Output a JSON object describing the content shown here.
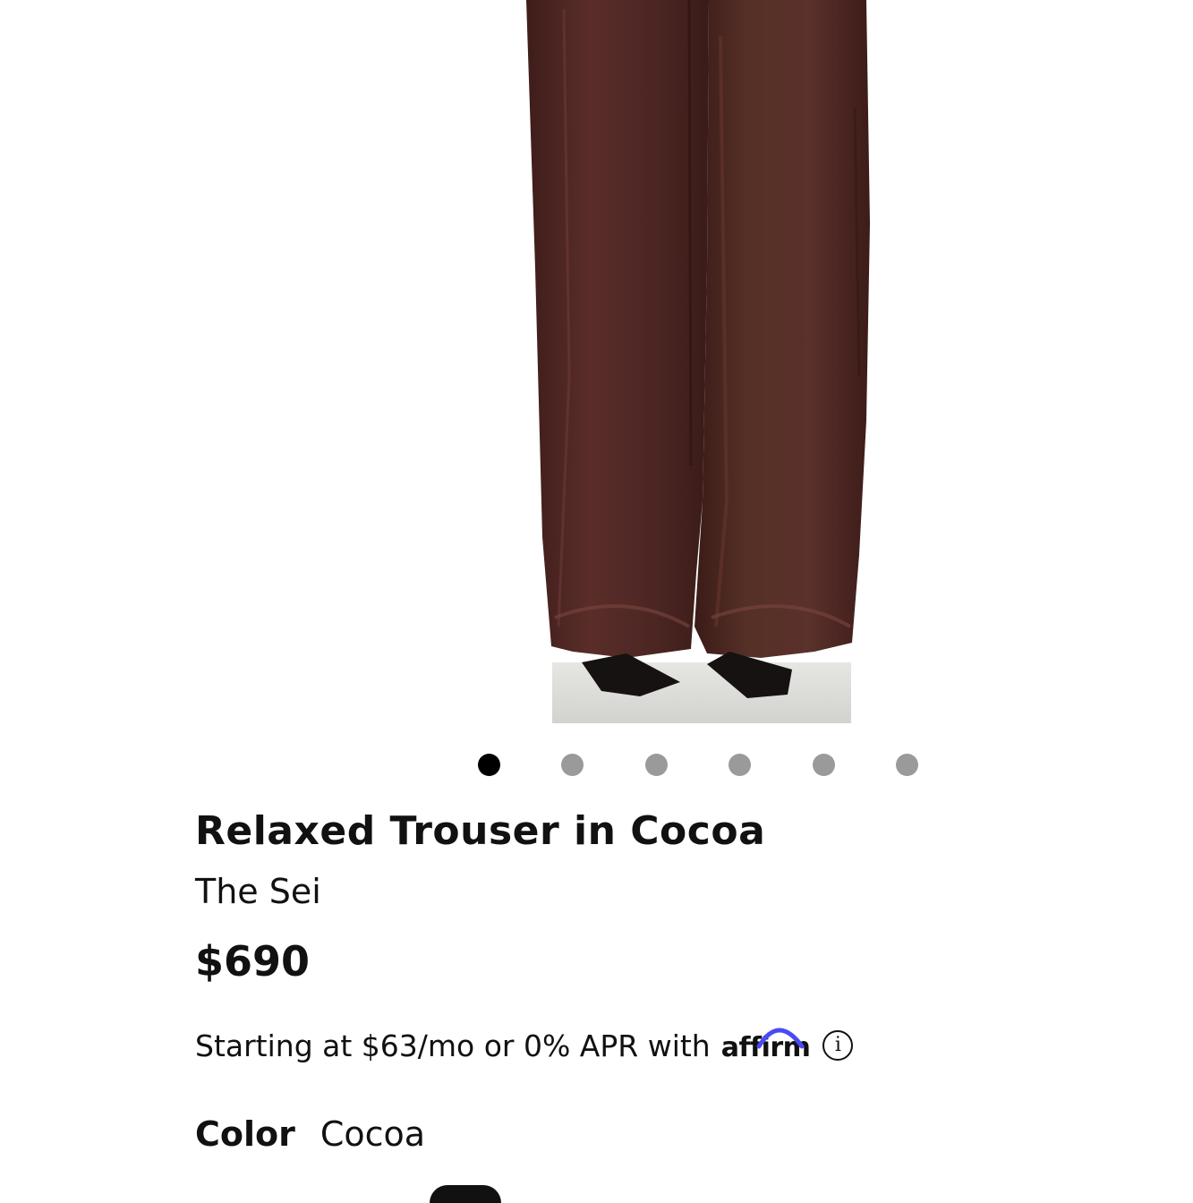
{
  "product": {
    "title": "Relaxed Trouser in Cocoa",
    "brand": "The Sei",
    "price": "$690"
  },
  "financing": {
    "text": "Starting at $63/mo or 0% APR with",
    "provider": "affirm"
  },
  "color": {
    "label": "Color",
    "value": "Cocoa"
  },
  "carousel": {
    "total": 6,
    "active_index": 0
  },
  "colors": {
    "accent": "#000000",
    "dot_inactive": "#9a9a9a",
    "affirm_arc": "#4a4af4",
    "trouser": "#4e2622"
  }
}
